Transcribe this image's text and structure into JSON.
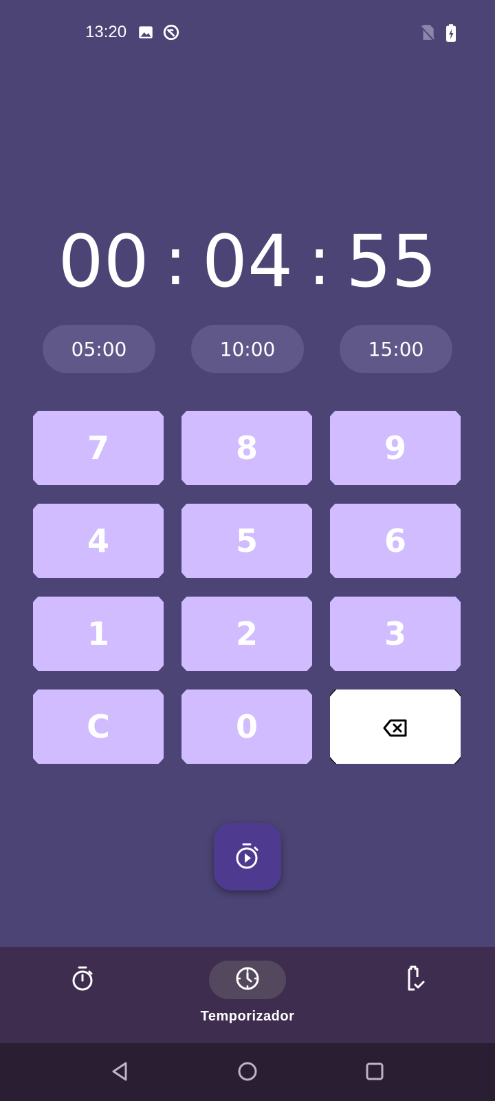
{
  "status_bar": {
    "time": "13:20",
    "icons": [
      "image-icon",
      "do-not-disturb-icon",
      "no-sim-icon",
      "battery-charging-icon"
    ]
  },
  "timer": {
    "hours": "00",
    "minutes": "04",
    "seconds": "55",
    "separator": ":"
  },
  "presets": [
    "05:00",
    "10:00",
    "15:00"
  ],
  "keypad": {
    "rows": [
      [
        "7",
        "8",
        "9"
      ],
      [
        "4",
        "5",
        "6"
      ],
      [
        "1",
        "2",
        "3"
      ],
      [
        "C",
        "0"
      ]
    ],
    "backspace_icon": "backspace-icon"
  },
  "fab": {
    "icon": "timer-play-icon"
  },
  "bottom_nav": {
    "items": [
      {
        "icon": "stopwatch-icon",
        "label": ""
      },
      {
        "icon": "timer-icon",
        "label": "Temporizador",
        "active": true
      },
      {
        "icon": "battery-check-icon",
        "label": ""
      }
    ]
  },
  "system_nav": [
    "back-icon",
    "home-icon",
    "recents-icon"
  ],
  "colors": {
    "background": "#4b4474",
    "preset_bg": "#5f5889",
    "key_bg": "#d0bcff",
    "fab_bg": "#4e3a8e",
    "bottom_nav_bg": "#3f2d4f",
    "system_nav_bg": "#2a1e33"
  }
}
